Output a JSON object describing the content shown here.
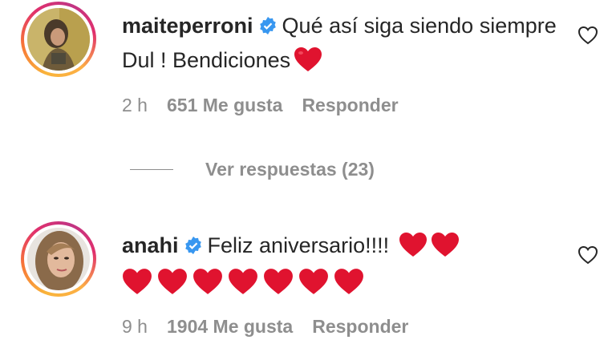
{
  "comments": [
    {
      "username": "maiteperroni",
      "text": "Qué así siga siendo siempre Dul ! Bendiciones",
      "time": "2 h",
      "likes": "651 Me gusta",
      "reply": "Responder"
    },
    {
      "username": "anahi",
      "text": "Feliz aniversario!!!!",
      "time": "9 h",
      "likes": "1904 Me gusta",
      "reply": "Responder"
    }
  ],
  "view_replies": "Ver respuestas (23)",
  "icons": {
    "verified": "verified-badge-icon",
    "heart": "red-heart-emoji",
    "like": "heart-outline-icon"
  },
  "colors": {
    "verified": "#3897f0",
    "heart": "#e0132f",
    "meta": "#8e8e8e"
  }
}
